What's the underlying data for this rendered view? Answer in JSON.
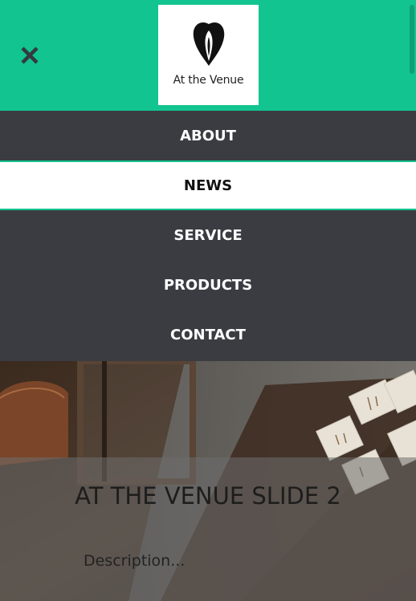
{
  "header": {
    "close_label": "✕",
    "logo_text": "At the Venue",
    "background": "#12c48f"
  },
  "nav": {
    "items": [
      {
        "label": "ABOUT",
        "active": false
      },
      {
        "label": "NEWS",
        "active": true
      },
      {
        "label": "SERVICE",
        "active": false
      },
      {
        "label": "PRODUCTS",
        "active": false
      },
      {
        "label": "CONTACT",
        "active": false
      }
    ]
  },
  "slide": {
    "title": "AT THE VENUE SLIDE 2",
    "description": "Description..."
  },
  "colors": {
    "accent": "#12c48f",
    "nav_bg": "#3a3c42",
    "active_bg": "#ffffff"
  },
  "icons": {
    "close": "close-icon",
    "logo": "venue-logo-icon"
  }
}
